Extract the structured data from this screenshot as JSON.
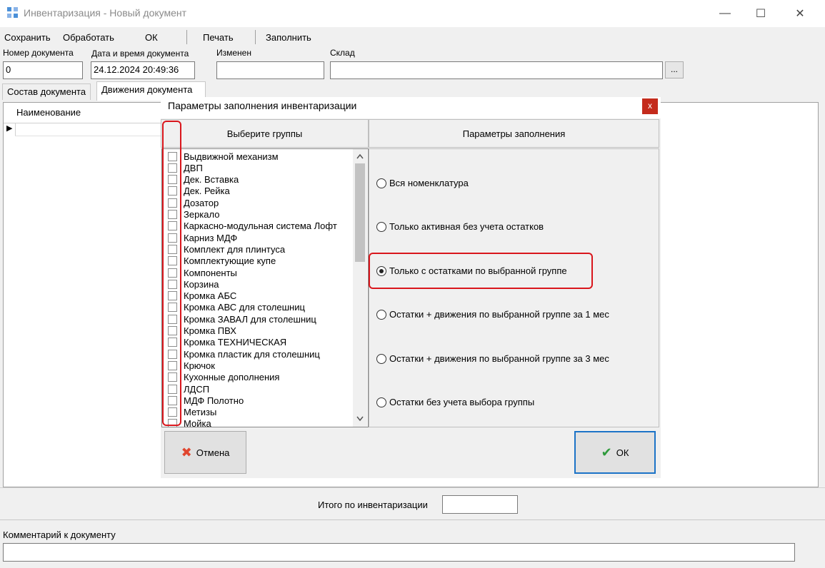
{
  "window": {
    "title": "Инвентаризация - Новый документ",
    "minimize_glyph": "—",
    "maximize_glyph": "☐",
    "close_glyph": "✕"
  },
  "toolbar": {
    "save": "Сохранить",
    "process": "Обработать",
    "ok": "ОК",
    "print": "Печать",
    "fill": "Заполнить"
  },
  "fields": {
    "doc_number_label": "Номер документа",
    "doc_number_value": "0",
    "doc_datetime_label": "Дата и время документа",
    "doc_datetime_value": "24.12.2024  20:49:36",
    "changed_label": "Изменен",
    "changed_value": "",
    "warehouse_label": "Склад",
    "warehouse_value": "",
    "browse_label": "..."
  },
  "tabs": [
    {
      "label": "Состав документа",
      "active": false
    },
    {
      "label": "Движения документа",
      "active": true
    }
  ],
  "grid": {
    "columns": [
      "Наименование"
    ],
    "row_marker": "▶"
  },
  "dialog": {
    "title": "Параметры заполнения инвентаризации",
    "close_glyph": "x",
    "groups_header": "Выберите группы",
    "params_header": "Параметры заполнения",
    "groups": [
      "Выдвижной механизм",
      "ДВП",
      "Дек. Вставка",
      "Дек. Рейка",
      "Дозатор",
      "Зеркало",
      "Каркасно-модульная система Лофт",
      "Карниз МДФ",
      "Комплект для плинтуса",
      "Комплектующие купе",
      "Компоненты",
      "Корзина",
      "Кромка АБС",
      "Кромка АВС для столешниц",
      "Кромка ЗАВАЛ для столешниц",
      "Кромка ПВХ",
      "Кромка ТЕХНИЧЕСКАЯ",
      "Кромка пластик для столешниц",
      "Крючок",
      "Кухонные дополнения",
      "ЛДСП",
      "МДФ Полотно",
      "Метизы",
      "Мойка"
    ],
    "options": [
      {
        "label": "Вся номенклатура",
        "checked": false
      },
      {
        "label": "Только активная без учета остатков",
        "checked": false
      },
      {
        "label": "Только с остатками по выбранной группе",
        "checked": true
      },
      {
        "label": "Остатки + движения по выбранной группе за 1 мес",
        "checked": false
      },
      {
        "label": "Остатки + движения по выбранной группе за 3 мес",
        "checked": false
      },
      {
        "label": "Остатки без учета выбора группы",
        "checked": false
      }
    ],
    "cancel_label": "Отмена",
    "ok_label": "ОК",
    "cancel_icon": "✖",
    "ok_icon": "✔"
  },
  "totals": {
    "label": "Итого по инвентаризации",
    "value": ""
  },
  "comment": {
    "label": "Комментарий к документу",
    "value": ""
  },
  "colors": {
    "highlight": "#d9161c",
    "cancel_icon": "#e0462f",
    "ok_icon": "#2e9a3b",
    "ok_border": "#1c73c7",
    "close_bg": "#c42b1c"
  }
}
